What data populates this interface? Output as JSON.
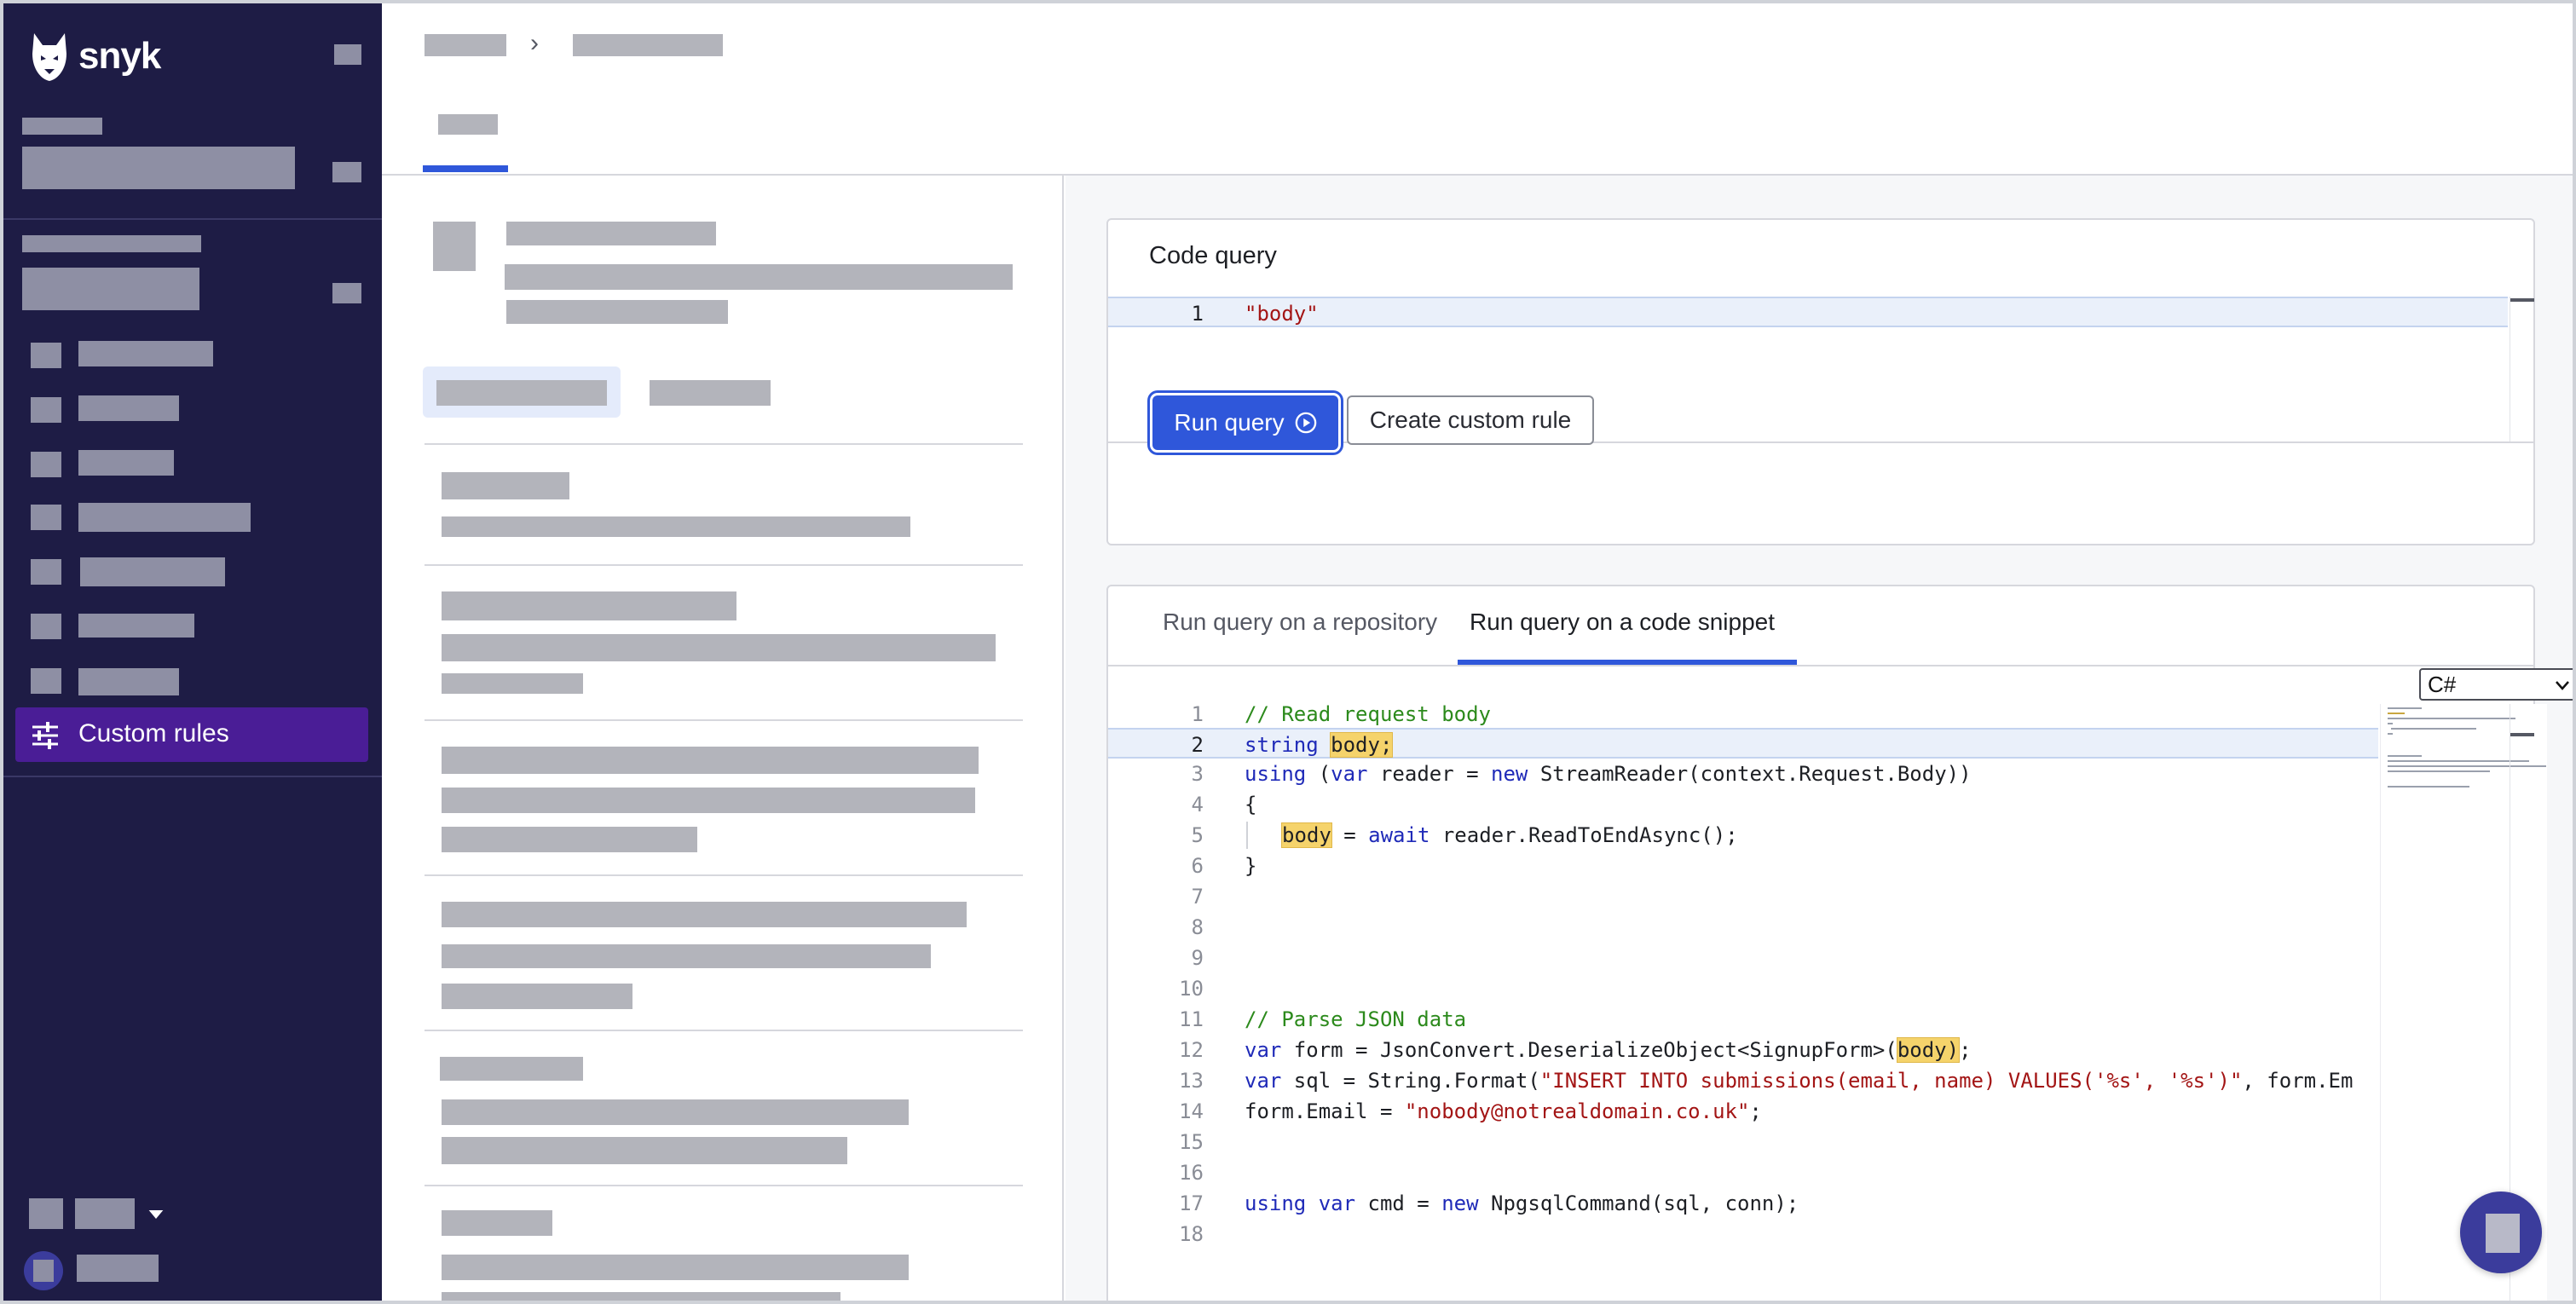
{
  "brand": {
    "name": "snyk"
  },
  "sidebar": {
    "active_item": {
      "label": "Custom rules",
      "icon": "sliders-icon"
    }
  },
  "code_query": {
    "title": "Code query",
    "lines": [
      {
        "number": "1",
        "text": "\"body\""
      }
    ],
    "run_button": "Run query",
    "run_icon": "play-circle-icon",
    "create_button": "Create custom rule"
  },
  "snippet": {
    "tabs": [
      {
        "label": "Run query on a repository",
        "active": false
      },
      {
        "label": "Run query on a code snippet",
        "active": true
      }
    ],
    "language": "C#",
    "line_numbers": [
      "1",
      "2",
      "3",
      "4",
      "5",
      "6",
      "7",
      "8",
      "9",
      "10",
      "11",
      "12",
      "13",
      "14",
      "15",
      "16",
      "17",
      "18"
    ],
    "code": {
      "l1": "// Read request body",
      "l2a": "string ",
      "l2b": "body;",
      "l3a": "using",
      "l3b": " (",
      "l3c": "var",
      "l3d": " reader = ",
      "l3e": "new",
      "l3f": " StreamReader(context.Request.Body))",
      "l4": "{",
      "l5a": "body",
      "l5b": " = ",
      "l5c": "await",
      "l5d": " reader.ReadToEndAsync();",
      "l6": "}",
      "l11": "// Parse JSON data",
      "l12a": "var",
      "l12b": " form = JsonConvert.DeserializeObject<SignupForm>(",
      "l12c": "body)",
      "l12d": ";",
      "l13a": "var",
      "l13b": " sql = String.Format(",
      "l13c": "\"INSERT INTO submissions(email, name) VALUES('%s', '%s')\"",
      "l13d": ", form.Em",
      "l14a": "form.Email = ",
      "l14b": "\"nobody@notrealdomain.co.uk\"",
      "l14c": ";",
      "l17a": "using",
      "l17b": " ",
      "l17c": "var",
      "l17d": " cmd = ",
      "l17e": "new",
      "l17f": " NpgsqlCommand(sql, conn);"
    }
  },
  "colors": {
    "sidebar_bg": "#1e1c45",
    "active_nav": "#4a1d96",
    "accent": "#2f57da",
    "match_highlight": "#f5d36b"
  }
}
